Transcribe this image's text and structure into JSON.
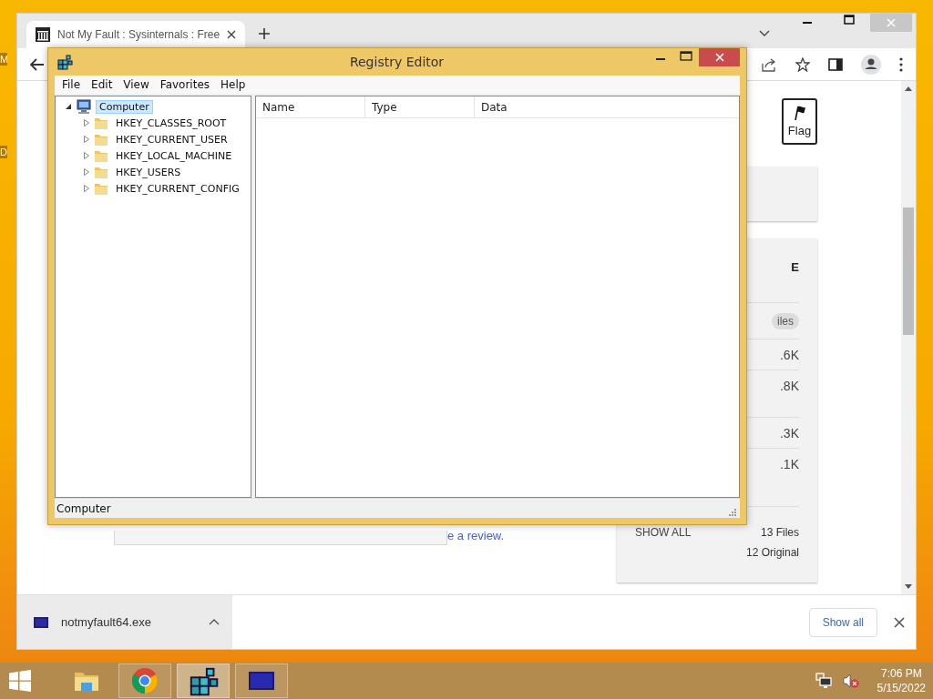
{
  "desktop": {
    "icon_labels": [
      "M",
      "D"
    ]
  },
  "browser": {
    "tabs": [
      {
        "title": "Not My Fault : Sysinternals : Free",
        "selected": true
      }
    ]
  },
  "page": {
    "flag_button": "Flag",
    "side_card": {
      "heading": "E",
      "filter_chip": "iles",
      "sizes": [
        ".6K",
        ".8K",
        ".3K",
        ".1K"
      ],
      "show_all": "SHOW ALL",
      "files": "13 Files",
      "original": "12 Original"
    },
    "review_link": "e a review."
  },
  "downloads": {
    "items": [
      {
        "name": "notmyfault64.exe"
      }
    ],
    "show_all": "Show all"
  },
  "regedit": {
    "title": "Registry Editor",
    "menu": [
      "File",
      "Edit",
      "View",
      "Favorites",
      "Help"
    ],
    "tree": [
      {
        "label": "Computer",
        "expanded": true,
        "selected": true,
        "children": [
          {
            "label": "HKEY_CLASSES_ROOT",
            "expanded": false,
            "selected": false
          },
          {
            "label": "HKEY_CURRENT_USER",
            "expanded": false,
            "selected": false
          },
          {
            "label": "HKEY_LOCAL_MACHINE",
            "expanded": false,
            "selected": false
          },
          {
            "label": "HKEY_USERS",
            "expanded": false,
            "selected": false
          },
          {
            "label": "HKEY_CURRENT_CONFIG",
            "expanded": false,
            "selected": false
          }
        ]
      }
    ],
    "columns": [
      "Name",
      "Type",
      "Data"
    ],
    "status": "Computer"
  },
  "taskbar": {
    "apps": [
      {
        "kind": "explorer",
        "running": false,
        "active": false
      },
      {
        "kind": "chrome",
        "running": true,
        "active": false
      },
      {
        "kind": "regedit",
        "running": true,
        "active": true
      },
      {
        "kind": "bluescreen",
        "running": true,
        "active": false
      }
    ],
    "time": "7:06 PM",
    "date": "5/15/2022"
  }
}
